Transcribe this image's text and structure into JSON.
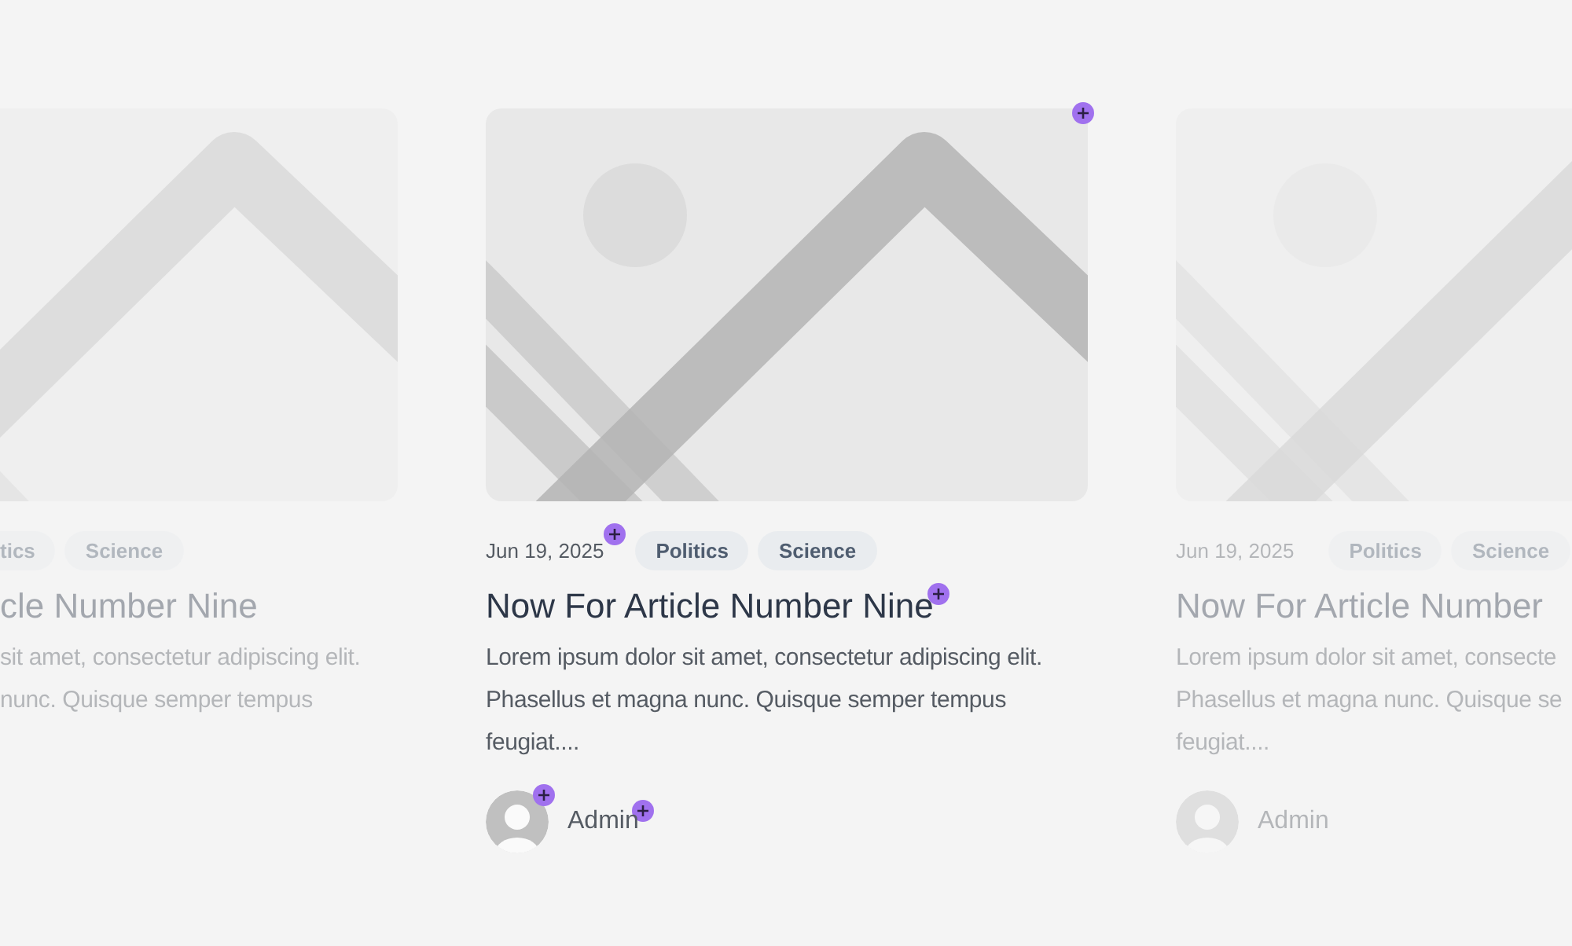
{
  "cards": [
    {
      "kind": "left",
      "faded": true,
      "image": {
        "kind": "picture"
      },
      "tags": [
        {
          "label": "tics"
        },
        {
          "label": "Science"
        }
      ],
      "title": "cle Number Nine",
      "excerpt_lines": [
        "sit amet, consectetur adipiscing elit.",
        "nunc. Quisque semper tempus"
      ]
    },
    {
      "kind": "center",
      "faded": false,
      "edit_markers": true,
      "image": {
        "kind": "picture"
      },
      "date": "Jun 19, 2025",
      "tags": [
        {
          "label": "Politics"
        },
        {
          "label": "Science"
        }
      ],
      "title": "Now For Article Number Nine",
      "excerpt": "Lorem ipsum dolor sit amet, consectetur adipiscing elit. Phasellus et magna nunc. Quisque semper tempus feugiat....",
      "author": "Admin"
    },
    {
      "kind": "right",
      "faded": true,
      "image": {
        "kind": "picture"
      },
      "date": "Jun 19, 2025",
      "tags": [
        {
          "label": "Politics"
        },
        {
          "label": "Science"
        }
      ],
      "title": "Now For Article Number",
      "excerpt_lines": [
        "Lorem ipsum dolor sit amet, consecte",
        "Phasellus et magna nunc. Quisque se",
        "feugiat...."
      ],
      "author": "Admin"
    }
  ]
}
